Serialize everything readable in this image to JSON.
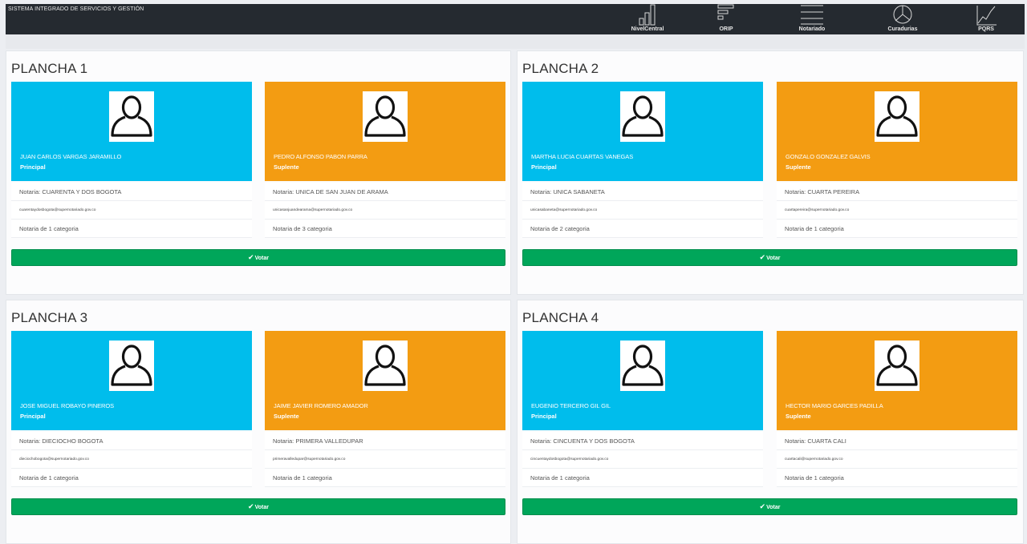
{
  "app": {
    "title": "SISTEMA INTEGRADO DE SERVICIOS Y GESTIÓN"
  },
  "nav": {
    "items": [
      {
        "label": "NivelCentral",
        "icon": "bar-chart-icon"
      },
      {
        "label": "ORIP",
        "icon": "horizontal-bars-icon"
      },
      {
        "label": "Notariado",
        "icon": "list-icon"
      },
      {
        "label": "Curadurias",
        "icon": "pie-chart-icon"
      },
      {
        "label": "PQRS",
        "icon": "line-chart-icon"
      }
    ]
  },
  "vote_label": "Votar",
  "colors": {
    "principal": "#00bdec",
    "suplente": "#f39c12",
    "vote": "#00a65a",
    "topbar": "#252a30"
  },
  "planchas": [
    {
      "title": "PLANCHA 1",
      "candidates": [
        {
          "name": "JUAN CARLOS VARGAS JARAMILLO",
          "role": "Principal",
          "notaria": "Notaria: CUARENTA Y DOS BOGOTA",
          "email": "cuarentaydosbogota@supernotariado.gov.co",
          "categoria": "Notaria de 1 categoria"
        },
        {
          "name": "PEDRO ALFONSO PABON PARRA",
          "role": "Suplente",
          "notaria": "Notaria: UNICA DE SAN JUAN DE ARAMA",
          "email": "unicasanjuandearama@supernotariado.gov.co",
          "categoria": "Notaria de 3 categoria"
        }
      ]
    },
    {
      "title": "PLANCHA 2",
      "candidates": [
        {
          "name": "MARTHA LUCIA CUARTAS VANEGAS",
          "role": "Principal",
          "notaria": "Notaria: UNICA SABANETA",
          "email": "unicasabaneta@supernotariado.gov.co",
          "categoria": "Notaria de 2 categoria"
        },
        {
          "name": "GONZALO GONZALEZ GALVIS",
          "role": "Suplente",
          "notaria": "Notaria: CUARTA PEREIRA",
          "email": "cuartapereira@supernotariado.gov.co",
          "categoria": "Notaria de 1 categoria"
        }
      ]
    },
    {
      "title": "PLANCHA 3",
      "candidates": [
        {
          "name": "JOSE MIGUEL ROBAYO PINEROS",
          "role": "Principal",
          "notaria": "Notaria: DIECIOCHO BOGOTA",
          "email": "dieciochobogota@supernotariado.gov.co",
          "categoria": "Notaria de 1 categoria"
        },
        {
          "name": "JAIME JAVIER ROMERO AMADOR",
          "role": "Suplente",
          "notaria": "Notaria: PRIMERA VALLEDUPAR",
          "email": "primeravalledupar@supernotariado.gov.co",
          "categoria": "Notaria de 1 categoria"
        }
      ]
    },
    {
      "title": "PLANCHA 4",
      "candidates": [
        {
          "name": "EUGENIO TERCERO GIL GIL",
          "role": "Principal",
          "notaria": "Notaria: CINCUENTA Y DOS BOGOTA",
          "email": "cincuentaydosbogota@supernotariado.gov.co",
          "categoria": "Notaria de 1 categoria"
        },
        {
          "name": "HECTOR MARIO GARCES PADILLA",
          "role": "Suplente",
          "notaria": "Notaria: CUARTA CALI",
          "email": "cuartacali@supernotariado.gov.co",
          "categoria": "Notaria de 1 categoria"
        }
      ]
    }
  ]
}
